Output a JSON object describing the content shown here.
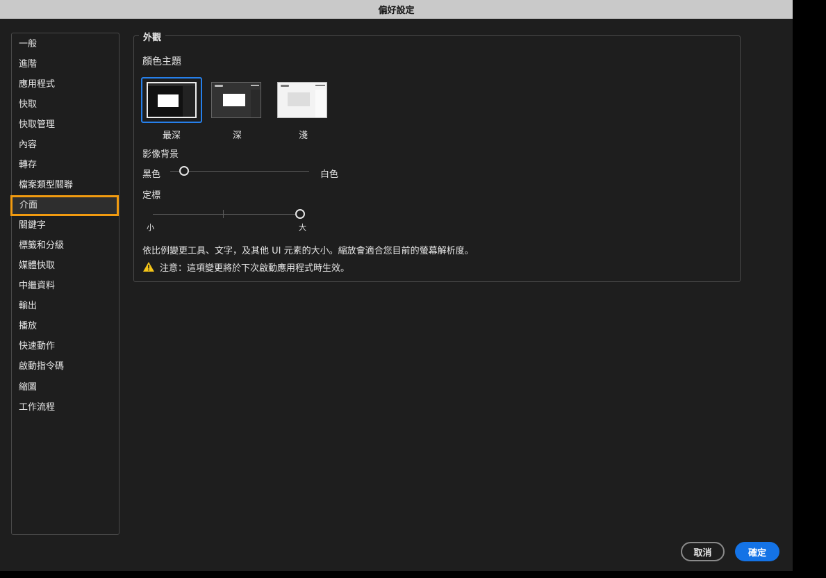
{
  "window": {
    "title": "偏好設定"
  },
  "sidebar": {
    "items": [
      {
        "label": "一般"
      },
      {
        "label": "進階"
      },
      {
        "label": "應用程式"
      },
      {
        "label": "快取"
      },
      {
        "label": "快取管理"
      },
      {
        "label": "內容"
      },
      {
        "label": "轉存"
      },
      {
        "label": "檔案類型關聯"
      },
      {
        "label": "介面",
        "selected": true
      },
      {
        "label": "關鍵字"
      },
      {
        "label": "標籤和分級"
      },
      {
        "label": "媒體快取"
      },
      {
        "label": "中繼資料"
      },
      {
        "label": "輸出"
      },
      {
        "label": "播放"
      },
      {
        "label": "快速動作"
      },
      {
        "label": "啟動指令碼"
      },
      {
        "label": "縮圖"
      },
      {
        "label": "工作流程"
      }
    ]
  },
  "appearance": {
    "section_title": "外觀",
    "color_theme_label": "顏色主題",
    "themes": [
      {
        "label": "最深",
        "selected": true
      },
      {
        "label": "深",
        "selected": false
      },
      {
        "label": "淺",
        "selected": false
      }
    ],
    "image_background": {
      "label": "影像背景",
      "min_label": "黑色",
      "max_label": "白色",
      "value": 0.1
    },
    "scale": {
      "label": "定標",
      "min_label": "小",
      "max_label": "大",
      "value": 1.0
    },
    "description": "依比例變更工具、文字，及其他 UI 元素的大小。縮放會適合您目前的螢幕解析度。",
    "note": "注意：這項變更將於下次啟動應用程式時生效。"
  },
  "footer": {
    "cancel_label": "取消",
    "ok_label": "確定"
  },
  "colors": {
    "accent": "#1473e6",
    "selection_outline": "#f29b10",
    "warning": "#f5c518"
  }
}
